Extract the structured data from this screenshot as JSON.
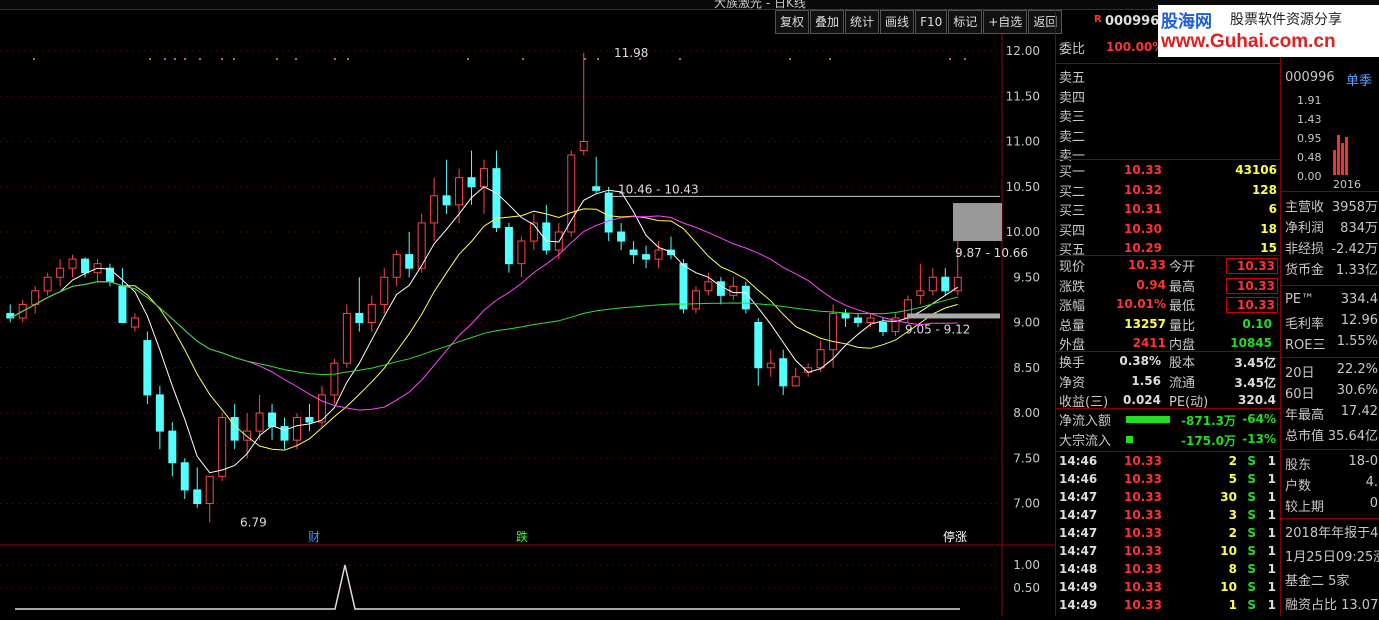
{
  "topbar": {
    "title": "大族激光 - 日K线"
  },
  "toolbar": [
    "复权",
    "叠加",
    "统计",
    "画线",
    "F10",
    "标记",
    "+自选",
    "返回"
  ],
  "stock": {
    "flag": "R",
    "code": "000996"
  },
  "logo": {
    "text1": "股海网",
    "text2": "股票软件资源分享",
    "url": "www.Guhai.com.cn"
  },
  "chart_data": {
    "type": "candlestick",
    "ylabels": [
      "12.00",
      "11.50",
      "11.00",
      "10.50",
      "10.00",
      "9.50",
      "9.00",
      "8.50",
      "8.00",
      "7.50",
      "7.00"
    ],
    "sub_ylabels": [
      "1.00",
      "0.50"
    ],
    "annotations": {
      "high": "11.98",
      "low": "6.79",
      "range1": "10.46 - 10.43",
      "range2": "9.87 - 10.66",
      "range3": "9.05 - 9.12"
    },
    "markers": [
      "财",
      "跌",
      "停涨"
    ],
    "candles": [
      [
        9.1,
        9.2,
        9.0,
        9.05
      ],
      [
        9.05,
        9.25,
        9.0,
        9.2
      ],
      [
        9.2,
        9.4,
        9.1,
        9.35
      ],
      [
        9.35,
        9.55,
        9.3,
        9.5
      ],
      [
        9.5,
        9.7,
        9.4,
        9.6
      ],
      [
        9.6,
        9.75,
        9.5,
        9.7
      ],
      [
        9.7,
        9.72,
        9.5,
        9.55
      ],
      [
        9.55,
        9.7,
        9.45,
        9.65
      ],
      [
        9.6,
        9.65,
        9.4,
        9.45
      ],
      [
        9.4,
        9.6,
        9.1,
        9.0
      ],
      [
        8.95,
        9.1,
        8.9,
        9.05
      ],
      [
        8.8,
        8.9,
        8.1,
        8.2
      ],
      [
        8.2,
        8.3,
        7.6,
        7.8
      ],
      [
        7.8,
        7.9,
        7.3,
        7.45
      ],
      [
        7.45,
        7.5,
        7.05,
        7.15
      ],
      [
        7.15,
        7.4,
        6.95,
        7.0
      ],
      [
        7.0,
        7.3,
        6.79,
        7.3
      ],
      [
        7.3,
        8.0,
        7.25,
        7.95
      ],
      [
        7.95,
        8.1,
        7.6,
        7.7
      ],
      [
        7.7,
        8.0,
        7.5,
        7.8
      ],
      [
        7.8,
        8.2,
        7.7,
        8.0
      ],
      [
        8.0,
        8.1,
        7.7,
        7.85
      ],
      [
        7.85,
        7.95,
        7.6,
        7.7
      ],
      [
        7.7,
        8.0,
        7.6,
        7.95
      ],
      [
        7.95,
        8.1,
        7.8,
        7.9
      ],
      [
        7.9,
        8.3,
        7.85,
        8.2
      ],
      [
        8.2,
        8.6,
        8.1,
        8.55
      ],
      [
        8.55,
        9.2,
        8.5,
        9.1
      ],
      [
        9.1,
        9.5,
        8.9,
        9.0
      ],
      [
        9.0,
        9.3,
        8.9,
        9.2
      ],
      [
        9.2,
        9.6,
        9.1,
        9.5
      ],
      [
        9.5,
        9.8,
        9.4,
        9.75
      ],
      [
        9.75,
        10.0,
        9.5,
        9.6
      ],
      [
        9.6,
        10.2,
        9.55,
        10.1
      ],
      [
        10.1,
        10.6,
        9.9,
        10.4
      ],
      [
        10.4,
        10.8,
        10.2,
        10.3
      ],
      [
        10.3,
        10.7,
        10.1,
        10.6
      ],
      [
        10.6,
        10.9,
        10.3,
        10.5
      ],
      [
        10.5,
        10.8,
        10.2,
        10.7
      ],
      [
        10.7,
        10.9,
        10.0,
        10.05
      ],
      [
        10.05,
        10.1,
        9.55,
        9.65
      ],
      [
        9.65,
        9.95,
        9.5,
        9.9
      ],
      [
        9.9,
        10.2,
        9.8,
        10.1
      ],
      [
        10.1,
        10.3,
        9.75,
        9.8
      ],
      [
        9.8,
        10.1,
        9.7,
        10.0
      ],
      [
        10.0,
        10.9,
        9.95,
        10.85
      ],
      [
        10.9,
        11.98,
        10.85,
        11.0
      ],
      [
        10.5,
        10.83,
        10.43,
        10.46
      ],
      [
        10.43,
        10.5,
        9.9,
        10.0
      ],
      [
        10.0,
        10.1,
        9.8,
        9.9
      ],
      [
        9.8,
        9.9,
        9.65,
        9.75
      ],
      [
        9.75,
        9.85,
        9.6,
        9.7
      ],
      [
        9.7,
        9.9,
        9.6,
        9.8
      ],
      [
        9.8,
        9.95,
        9.7,
        9.75
      ],
      [
        9.65,
        9.7,
        9.1,
        9.15
      ],
      [
        9.15,
        9.4,
        9.1,
        9.35
      ],
      [
        9.35,
        9.55,
        9.3,
        9.45
      ],
      [
        9.45,
        9.5,
        9.2,
        9.3
      ],
      [
        9.3,
        9.5,
        9.25,
        9.4
      ],
      [
        9.4,
        9.45,
        9.1,
        9.15
      ],
      [
        9.0,
        9.05,
        8.3,
        8.5
      ],
      [
        8.5,
        8.7,
        8.4,
        8.55
      ],
      [
        8.6,
        8.7,
        8.2,
        8.3
      ],
      [
        8.3,
        8.5,
        8.3,
        8.4
      ],
      [
        8.45,
        8.55,
        8.4,
        8.5
      ],
      [
        8.5,
        8.8,
        8.45,
        8.7
      ],
      [
        8.7,
        9.2,
        8.5,
        9.1
      ],
      [
        9.1,
        9.15,
        8.95,
        9.05
      ],
      [
        9.05,
        9.1,
        8.95,
        9.0
      ],
      [
        9.0,
        9.1,
        8.95,
        9.05
      ],
      [
        9.0,
        9.05,
        8.85,
        8.9
      ],
      [
        8.9,
        9.1,
        8.85,
        9.05
      ],
      [
        9.05,
        9.3,
        9.0,
        9.25
      ],
      [
        9.3,
        9.65,
        9.2,
        9.35
      ],
      [
        9.35,
        9.6,
        9.3,
        9.5
      ],
      [
        9.5,
        9.6,
        9.3,
        9.35
      ],
      [
        9.35,
        9.9,
        9.3,
        9.5
      ]
    ]
  },
  "quote": {
    "weibi": {
      "label": "委比",
      "value": "100.00%"
    },
    "sell": [
      {
        "label": "卖五"
      },
      {
        "label": "卖四"
      },
      {
        "label": "卖三"
      },
      {
        "label": "卖二"
      },
      {
        "label": "卖一"
      }
    ],
    "buy": [
      {
        "label": "买一",
        "price": "10.33",
        "vol": "43106"
      },
      {
        "label": "买二",
        "price": "10.32",
        "vol": "128"
      },
      {
        "label": "买三",
        "price": "10.31",
        "vol": "6"
      },
      {
        "label": "买四",
        "price": "10.30",
        "vol": "18"
      },
      {
        "label": "买五",
        "price": "10.29",
        "vol": "15"
      }
    ],
    "stats": [
      [
        "现价",
        "10.33",
        "今开",
        "10.33"
      ],
      [
        "涨跌",
        "0.94",
        "最高",
        "10.33"
      ],
      [
        "涨幅",
        "10.01%",
        "最低",
        "10.33"
      ],
      [
        "总量",
        "13257",
        "量比",
        "0.10"
      ],
      [
        "外盘",
        "2411",
        "内盘",
        "10845"
      ]
    ],
    "stats2": [
      [
        "换手",
        "0.38%",
        "股本",
        "3.45亿"
      ],
      [
        "净资",
        "1.56",
        "流通",
        "3.45亿"
      ],
      [
        "收益(三)",
        "0.024",
        "PE(动)",
        "320.4"
      ]
    ],
    "flow": [
      {
        "label": "净流入额",
        "value": "-871.3万",
        "pct": "-64%"
      },
      {
        "label": "大宗流入",
        "value": "-175.0万",
        "pct": "-13%"
      }
    ],
    "ticks": [
      [
        "14:46",
        "10.33",
        "2",
        "S",
        "1"
      ],
      [
        "14:46",
        "10.33",
        "5",
        "S",
        "1"
      ],
      [
        "14:47",
        "10.33",
        "30",
        "S",
        "1"
      ],
      [
        "14:47",
        "10.33",
        "3",
        "S",
        "1"
      ],
      [
        "14:47",
        "10.33",
        "2",
        "S",
        "1"
      ],
      [
        "14:47",
        "10.33",
        "10",
        "S",
        "1"
      ],
      [
        "14:48",
        "10.33",
        "8",
        "S",
        "1"
      ],
      [
        "14:49",
        "10.33",
        "10",
        "S",
        "1"
      ],
      [
        "14:49",
        "10.33",
        "1",
        "S",
        "1"
      ]
    ]
  },
  "side": {
    "code": "000996",
    "tab": "单季",
    "yvals": [
      "1.91",
      "1.43",
      "0.95",
      "0.48",
      "0.00"
    ],
    "year": "2016",
    "fin": [
      [
        "主营收",
        "3958万"
      ],
      [
        "净利润",
        "834万"
      ],
      [
        "非经损",
        "-2.42万"
      ],
      [
        "货币金",
        "1.33亿"
      ]
    ],
    "ratio": [
      [
        "PE™",
        "334.4"
      ],
      [
        "毛利率",
        "12.96"
      ],
      [
        "ROE三",
        "1.55%"
      ]
    ],
    "perf": [
      [
        "20日",
        "22.2%"
      ],
      [
        "60日",
        "30.6%"
      ],
      [
        "年最高",
        "17.42"
      ],
      [
        "总市值",
        "35.64亿"
      ]
    ],
    "holders": [
      [
        "股东",
        "18-0"
      ],
      [
        "户数",
        "4."
      ],
      [
        "较上期",
        "0"
      ]
    ],
    "notes": [
      "2018年年报于4",
      "1月25日09:25涨",
      "基金二  5家",
      "融资占比 13.07"
    ]
  }
}
